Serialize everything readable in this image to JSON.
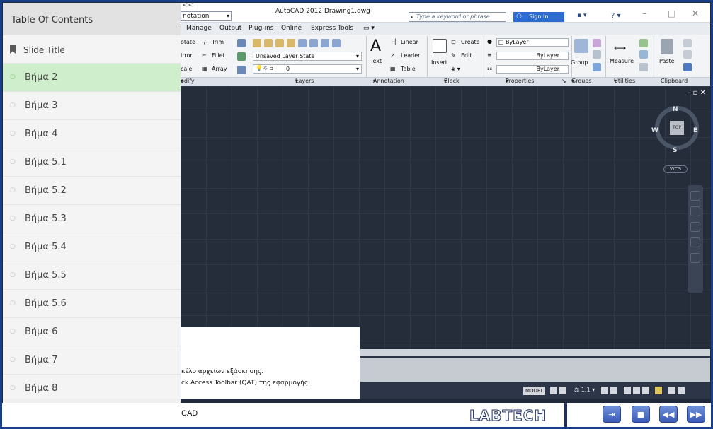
{
  "toc": {
    "header": "Table Of Contents",
    "items": [
      {
        "label": "Slide Title",
        "type": "title"
      },
      {
        "label": "Βήμα 2",
        "active": true
      },
      {
        "label": "Βήμα 3"
      },
      {
        "label": "Βήμα 4"
      },
      {
        "label": "Βήμα 5.1"
      },
      {
        "label": "Βήμα 5.2"
      },
      {
        "label": "Βήμα 5.3"
      },
      {
        "label": "Βήμα 5.4"
      },
      {
        "label": "Βήμα 5.5"
      },
      {
        "label": "Βήμα 5.6"
      },
      {
        "label": "Βήμα 6"
      },
      {
        "label": "Βήμα 7"
      },
      {
        "label": "Βήμα 8"
      }
    ],
    "active_color": "#cfeecb"
  },
  "autocad": {
    "back_glyph": "<<",
    "workspace": "notation",
    "title": "AutoCAD 2012",
    "file": "Drawing1.dwg",
    "search_placeholder": "Type a keyword or phrase",
    "sign_in": "Sign In",
    "menu": [
      "Manage",
      "Output",
      "Plug-ins",
      "Online",
      "Express Tools"
    ],
    "ribbon": {
      "modify": {
        "rotate": "otate",
        "mirror": "irror",
        "scale": "cale",
        "trim": "Trim",
        "fillet": "Fillet",
        "array": "Array",
        "label": "odify"
      },
      "layers": {
        "state": "Unsaved Layer State",
        "layer": "0",
        "label": "Layers"
      },
      "annotation": {
        "text": "Text",
        "linear": "Linear",
        "leader": "Leader",
        "table": "Table",
        "label": "Annotation"
      },
      "block": {
        "insert": "Insert",
        "create": "Create",
        "edit": "Edit",
        "label": "Block"
      },
      "properties": {
        "bylayer1": "ByLayer",
        "bylayer2": "ByLayer",
        "bylayer3": "ByLayer",
        "label": "Properties"
      },
      "groups": {
        "group": "Group",
        "label": "Groups"
      },
      "utilities": {
        "measure": "Measure",
        "label": "Utilities"
      },
      "clipboard": {
        "paste": "Paste",
        "label": "Clipboard"
      }
    },
    "viewcube": {
      "n": "N",
      "s": "S",
      "e": "E",
      "w": "W",
      "face": "TOP",
      "wcs": "WCS"
    },
    "popup_lines": [
      "κέλο αρχείων εξάσκησης.",
      "ck Access Toolbar (QAT) της εφαρμογής."
    ],
    "status_model": "MODEL",
    "annotation_scale": "1:1"
  },
  "player": {
    "caption": "CAD",
    "logo": "LABTECH",
    "buttons": [
      "next-slide",
      "stop",
      "rewind",
      "fast-forward"
    ]
  },
  "colors": {
    "frame_border": "#1a3f8a",
    "sign_in": "#2e6bd1",
    "player_button": "#3b5cb5"
  }
}
